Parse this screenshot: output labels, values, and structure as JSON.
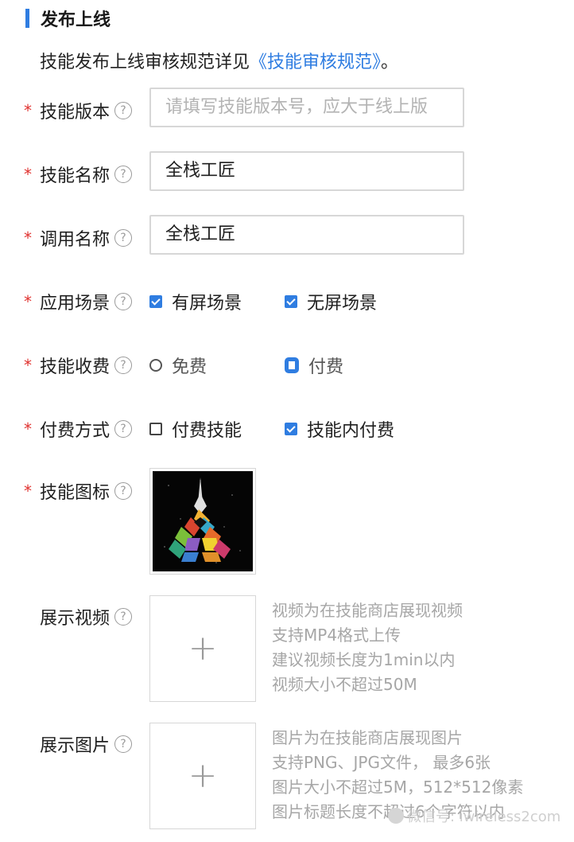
{
  "section": {
    "title": "发布上线"
  },
  "intro": {
    "text": "技能发布上线审核规范详见",
    "link": "《技能审核规范》",
    "suffix": "。"
  },
  "help_glyph": "?",
  "required_mark": "*",
  "fields": {
    "version": {
      "label": "技能版本",
      "placeholder": "请填写技能版本号，应大于线上版"
    },
    "skill_name": {
      "label": "技能名称",
      "value": "全栈工匠"
    },
    "invoke_name": {
      "label": "调用名称",
      "value": "全栈工匠"
    },
    "scenario": {
      "label": "应用场景",
      "options": [
        {
          "label": "有屏场景",
          "checked": true
        },
        {
          "label": "无屏场景",
          "checked": true
        }
      ]
    },
    "charge": {
      "label": "技能收费",
      "options": [
        {
          "label": "免费",
          "selected": false
        },
        {
          "label": "付费",
          "selected": true
        }
      ]
    },
    "pay_method": {
      "label": "付费方式",
      "options": [
        {
          "label": "付费技能",
          "checked": false
        },
        {
          "label": "技能内付费",
          "checked": true
        }
      ]
    },
    "icon": {
      "label": "技能图标"
    },
    "video": {
      "label": "展示视频",
      "upload_glyph": "+",
      "hints": [
        "视频为在技能商店展现视频",
        "支持MP4格式上传",
        "建议视频长度为1min以内",
        "视频大小不超过50M"
      ]
    },
    "images": {
      "label": "展示图片",
      "upload_glyph": "+",
      "hints": [
        "图片为在技能商店展现图片",
        "支持PNG、JPG文件， 最多6张",
        "图片大小不超过5M，512*512像素",
        "图片标题长度不超过6个字符以内"
      ]
    }
  },
  "watermark": "微信号: iwireless2com",
  "colors": {
    "accent": "#2f7de1",
    "required": "#e0322f",
    "hint": "#a6a6a6"
  }
}
